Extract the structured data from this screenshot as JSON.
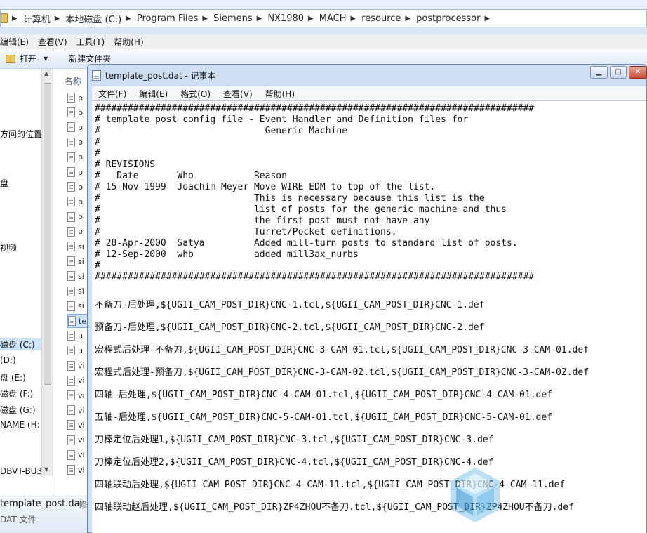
{
  "explorer": {
    "breadcrumb": [
      "计算机",
      "本地磁盘 (C:)",
      "Program Files",
      "Siemens",
      "NX1980",
      "MACH",
      "resource",
      "postprocessor"
    ],
    "menu": [
      "编辑(E)",
      "查看(V)",
      "工具(T)",
      "帮助(H)"
    ],
    "toolbar": {
      "open_label": "打开",
      "new_folder_label": "新建文件夹"
    },
    "nav_items": [
      "方问的位置",
      "盘",
      "视频",
      "磁盘 (C:)",
      "(D:)",
      "盘 (E:)",
      "磁盘 (F:)",
      "磁盘 (G:)",
      "NAME (H:",
      "DBVT-BU3"
    ],
    "column_header": "名称",
    "file_prefixes": [
      "p",
      "p",
      "p",
      "p",
      "p",
      "p",
      "p",
      "p",
      "p",
      "p",
      "si",
      "si",
      "si",
      "si",
      "si",
      "te",
      "u",
      "u",
      "vi",
      "vi",
      "vi",
      "vi",
      "vi",
      "vi",
      "vi",
      "vi"
    ],
    "details": {
      "name": "template_post.dat",
      "name_suffix": "修",
      "type": "DAT 文件"
    }
  },
  "notepad": {
    "title": "template_post.dat - 记事本",
    "menu": [
      "文件(F)",
      "编辑(E)",
      "格式(O)",
      "查看(V)",
      "帮助(H)"
    ],
    "header_lines": [
      "################################################################################",
      "# template_post config file - Event Handler and Definition files for",
      "#                              Generic Machine",
      "#",
      "#",
      "# REVISIONS",
      "#   Date       Who           Reason",
      "# 15-Nov-1999  Joachim Meyer Move WIRE EDM to top of the list.",
      "#                            This is necessary because this list is the",
      "#                            list of posts for the generic machine and thus",
      "#                            the first post must not have any",
      "#                            Turret/Pocket definitions.",
      "# 28-Apr-2000  Satya         Added mill-turn posts to standard list of posts.",
      "# 12-Sep-2000  whb           added mill3ax_nurbs",
      "#",
      "################################################################################"
    ],
    "entries": [
      "不备刀-后处理,${UGII_CAM_POST_DIR}CNC-1.tcl,${UGII_CAM_POST_DIR}CNC-1.def",
      "预备刀-后处理,${UGII_CAM_POST_DIR}CNC-2.tcl,${UGII_CAM_POST_DIR}CNC-2.def",
      "宏程式后处理-不备刀,${UGII_CAM_POST_DIR}CNC-3-CAM-01.tcl,${UGII_CAM_POST_DIR}CNC-3-CAM-01.def",
      "宏程式后处理-预备刀,${UGII_CAM_POST_DIR}CNC-3-CAM-02.tcl,${UGII_CAM_POST_DIR}CNC-3-CAM-02.def",
      "四轴-后处理,${UGII_CAM_POST_DIR}CNC-4-CAM-01.tcl,${UGII_CAM_POST_DIR}CNC-4-CAM-01.def",
      "五轴-后处理,${UGII_CAM_POST_DIR}CNC-5-CAM-01.tcl,${UGII_CAM_POST_DIR}CNC-5-CAM-01.def",
      "刀棒定位后处理1,${UGII_CAM_POST_DIR}CNC-3.tcl,${UGII_CAM_POST_DIR}CNC-3.def",
      "刀棒定位后处理2,${UGII_CAM_POST_DIR}CNC-4.tcl,${UGII_CAM_POST_DIR}CNC-4.def",
      "四轴联动后处理,${UGII_CAM_POST_DIR}CNC-4-CAM-11.tcl,${UGII_CAM_POST_DIR}CNC-4-CAM-11.def",
      "四轴联动赵后处理,${UGII_CAM_POST_DIR}ZP4ZHOU不备刀.tcl,${UGII_CAM_POST_DIR}ZP4ZHOU不备刀.def"
    ]
  },
  "colors": {
    "title_bar": "#cfdff1",
    "selection": "#cde4fb",
    "close_button": "#c9503a",
    "watermark": "#3aa0dc"
  }
}
